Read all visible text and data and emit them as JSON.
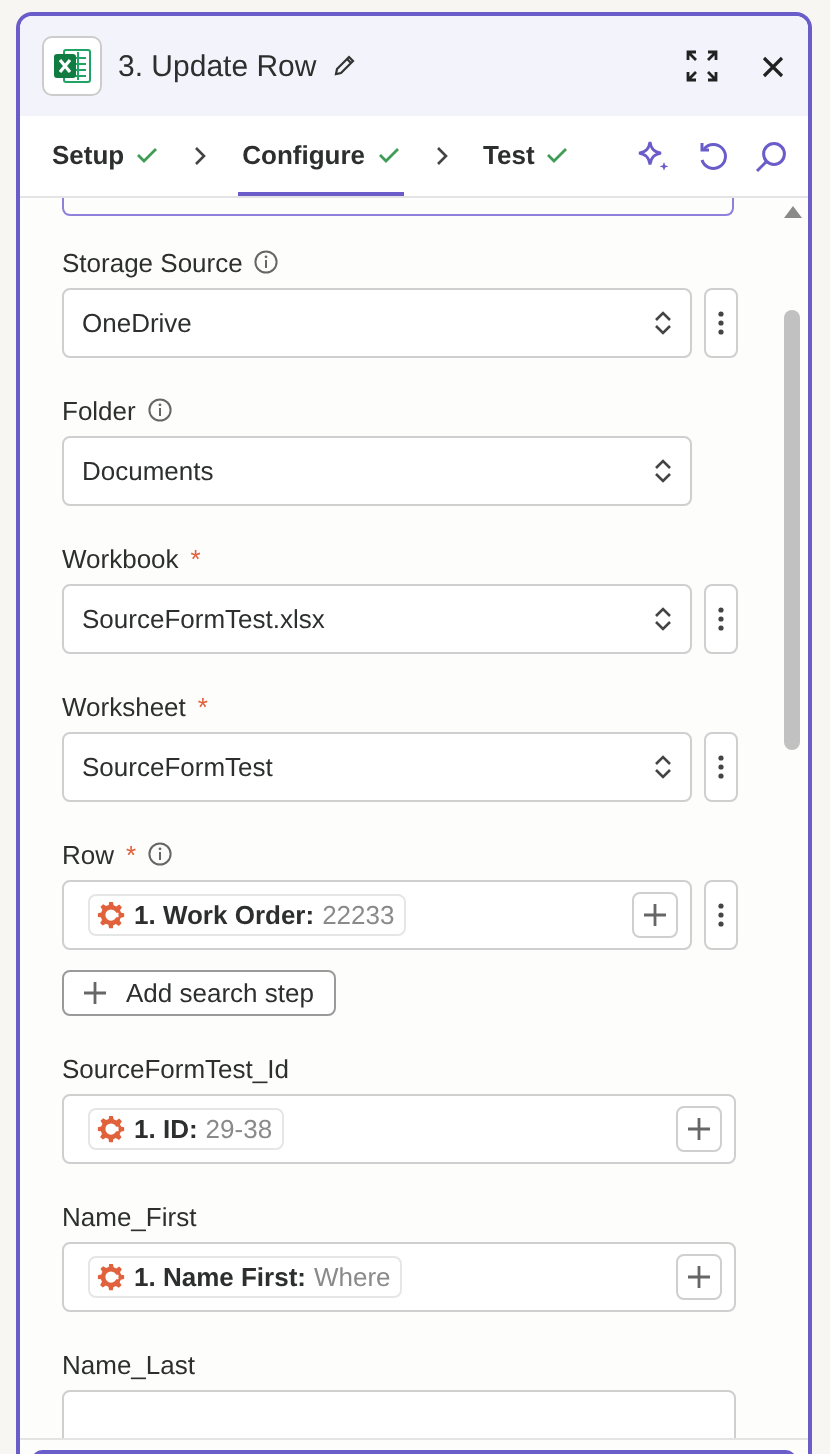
{
  "header": {
    "title": "3. Update Row"
  },
  "tabs": [
    {
      "label": "Setup",
      "done": true,
      "selected": false
    },
    {
      "label": "Configure",
      "done": true,
      "selected": true
    },
    {
      "label": "Test",
      "done": true,
      "selected": false
    }
  ],
  "fields": [
    {
      "kind": "select",
      "label": "Storage Source",
      "info": true,
      "value": "OneDrive",
      "menu": true
    },
    {
      "kind": "select",
      "label": "Folder",
      "info": true,
      "value": "Documents",
      "menu": false
    },
    {
      "kind": "select",
      "label": "Workbook",
      "required_mark": "*",
      "info": false,
      "value": "SourceFormTest.xlsx",
      "menu": true
    },
    {
      "kind": "select",
      "label": "Worksheet",
      "required_mark": "*",
      "info": false,
      "value": "SourceFormTest",
      "menu": true
    },
    {
      "kind": "mapped",
      "label": "Row",
      "required_mark": "*",
      "info": true,
      "chip_label": "1. Work Order:",
      "chip_value": "22233",
      "menu": true,
      "action": "Add search step"
    },
    {
      "kind": "mapped",
      "label": "SourceFormTest_Id",
      "info": false,
      "chip_label": "1. ID:",
      "chip_value": "29-38",
      "menu": false
    },
    {
      "kind": "mapped",
      "label": "Name_First",
      "info": false,
      "chip_label": "1. Name First:",
      "chip_value": "Where",
      "menu": false
    },
    {
      "kind": "mapped",
      "label": "Name_Last",
      "info": false
    }
  ]
}
